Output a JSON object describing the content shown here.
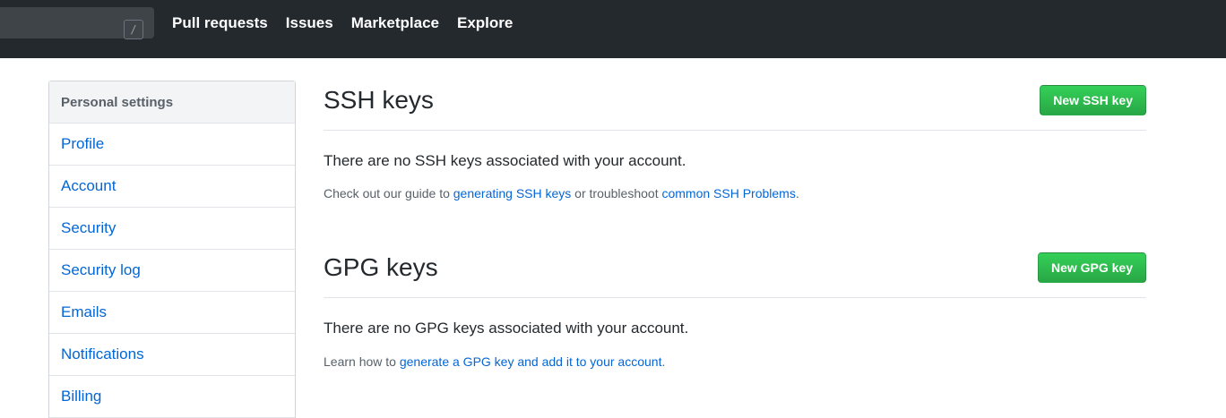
{
  "header": {
    "search_shortcut": "/",
    "nav": [
      "Pull requests",
      "Issues",
      "Marketplace",
      "Explore"
    ]
  },
  "sidebar": {
    "heading": "Personal settings",
    "items": [
      "Profile",
      "Account",
      "Security",
      "Security log",
      "Emails",
      "Notifications",
      "Billing"
    ]
  },
  "ssh": {
    "title": "SSH keys",
    "button": "New SSH key",
    "empty": "There are no SSH keys associated with your account.",
    "help_prefix": "Check out our guide to ",
    "help_link1": "generating SSH keys",
    "help_middle": " or troubleshoot ",
    "help_link2": "common SSH Problems",
    "help_suffix": "."
  },
  "gpg": {
    "title": "GPG keys",
    "button": "New GPG key",
    "empty": "There are no GPG keys associated with your account.",
    "help_prefix": "Learn how to ",
    "help_link": "generate a GPG key and add it to your account",
    "help_suffix": "."
  },
  "colors": {
    "header_bg": "#24292e",
    "link": "#0366d6",
    "button_green": "#28a745"
  }
}
